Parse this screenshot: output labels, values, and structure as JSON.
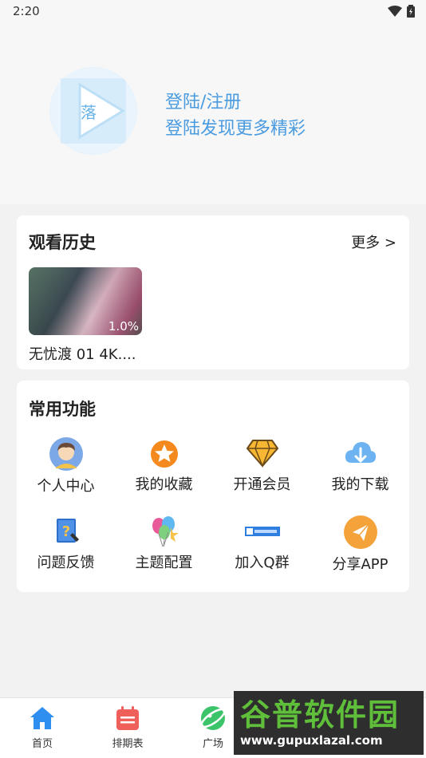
{
  "status_bar": {
    "time": "2:20"
  },
  "profile": {
    "login_title": "登陆/注册",
    "login_subtitle": "登陆发现更多精彩",
    "avatar_text": "落"
  },
  "history": {
    "title": "观看历史",
    "more_label": "更多 >",
    "items": [
      {
        "name": "无忧渡 01 4K....",
        "progress": "1.0%"
      }
    ]
  },
  "functions": {
    "title": "常用功能",
    "items": [
      {
        "label": "个人中心",
        "icon": "person-icon"
      },
      {
        "label": "我的收藏",
        "icon": "star-icon"
      },
      {
        "label": "开通会员",
        "icon": "diamond-icon"
      },
      {
        "label": "我的下载",
        "icon": "cloud-download-icon"
      },
      {
        "label": "问题反馈",
        "icon": "feedback-icon"
      },
      {
        "label": "主题配置",
        "icon": "balloons-icon"
      },
      {
        "label": "加入Q群",
        "icon": "qq-group-icon"
      },
      {
        "label": "分享APP",
        "icon": "share-icon"
      }
    ]
  },
  "tabs": [
    {
      "label": "首页",
      "icon": "home-icon"
    },
    {
      "label": "排期表",
      "icon": "calendar-icon"
    },
    {
      "label": "广场",
      "icon": "planet-icon"
    }
  ],
  "watermark": {
    "title": "谷普软件园",
    "url": "www.gupuxlazal.com"
  },
  "colors": {
    "accent": "#4a9be0",
    "tab_active": "#2f8ff0",
    "watermark_green": "#5fbf3a"
  }
}
